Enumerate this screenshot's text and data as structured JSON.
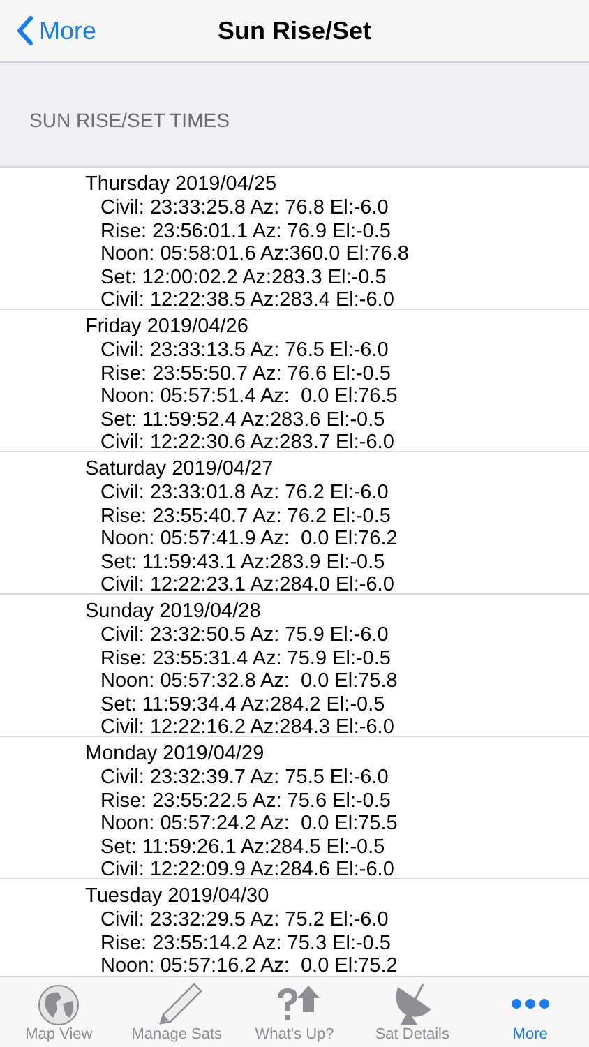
{
  "nav": {
    "back": "More",
    "title": "Sun Rise/Set"
  },
  "section": {
    "header": "SUN RISE/SET TIMES"
  },
  "days": [
    {
      "date": "Thursday 2019/04/25",
      "lines": [
        "Civil: 23:33:25.8 Az: 76.8 El:-6.0",
        "Rise: 23:56:01.1 Az: 76.9 El:-0.5",
        "Noon: 05:58:01.6 Az:360.0 El:76.8",
        "Set: 12:00:02.2 Az:283.3 El:-0.5",
        "Civil: 12:22:38.5 Az:283.4 El:-6.0"
      ]
    },
    {
      "date": "Friday 2019/04/26",
      "lines": [
        "Civil: 23:33:13.5 Az: 76.5 El:-6.0",
        "Rise: 23:55:50.7 Az: 76.6 El:-0.5",
        "Noon: 05:57:51.4 Az:  0.0 El:76.5",
        "Set: 11:59:52.4 Az:283.6 El:-0.5",
        "Civil: 12:22:30.6 Az:283.7 El:-6.0"
      ]
    },
    {
      "date": "Saturday 2019/04/27",
      "lines": [
        "Civil: 23:33:01.8 Az: 76.2 El:-6.0",
        "Rise: 23:55:40.7 Az: 76.2 El:-0.5",
        "Noon: 05:57:41.9 Az:  0.0 El:76.2",
        "Set: 11:59:43.1 Az:283.9 El:-0.5",
        "Civil: 12:22:23.1 Az:284.0 El:-6.0"
      ]
    },
    {
      "date": "Sunday 2019/04/28",
      "lines": [
        "Civil: 23:32:50.5 Az: 75.9 El:-6.0",
        "Rise: 23:55:31.4 Az: 75.9 El:-0.5",
        "Noon: 05:57:32.8 Az:  0.0 El:75.8",
        "Set: 11:59:34.4 Az:284.2 El:-0.5",
        "Civil: 12:22:16.2 Az:284.3 El:-6.0"
      ]
    },
    {
      "date": "Monday 2019/04/29",
      "lines": [
        "Civil: 23:32:39.7 Az: 75.5 El:-6.0",
        "Rise: 23:55:22.5 Az: 75.6 El:-0.5",
        "Noon: 05:57:24.2 Az:  0.0 El:75.5",
        "Set: 11:59:26.1 Az:284.5 El:-0.5",
        "Civil: 12:22:09.9 Az:284.6 El:-6.0"
      ]
    },
    {
      "date": "Tuesday 2019/04/30",
      "lines": [
        "Civil: 23:32:29.5 Az: 75.2 El:-6.0",
        "Rise: 23:55:14.2 Az: 75.3 El:-0.5",
        "Noon: 05:57:16.2 Az:  0.0 El:75.2"
      ]
    }
  ],
  "tab_bar": [
    {
      "label": "Map View",
      "kind": "globe",
      "selected": false
    },
    {
      "label": "Manage Sats",
      "kind": "pencil",
      "selected": false
    },
    {
      "label": "What's Up?",
      "kind": "question",
      "selected": false
    },
    {
      "label": "Sat Details",
      "kind": "dish",
      "selected": false
    },
    {
      "label": "More",
      "kind": "dots",
      "selected": true
    }
  ]
}
